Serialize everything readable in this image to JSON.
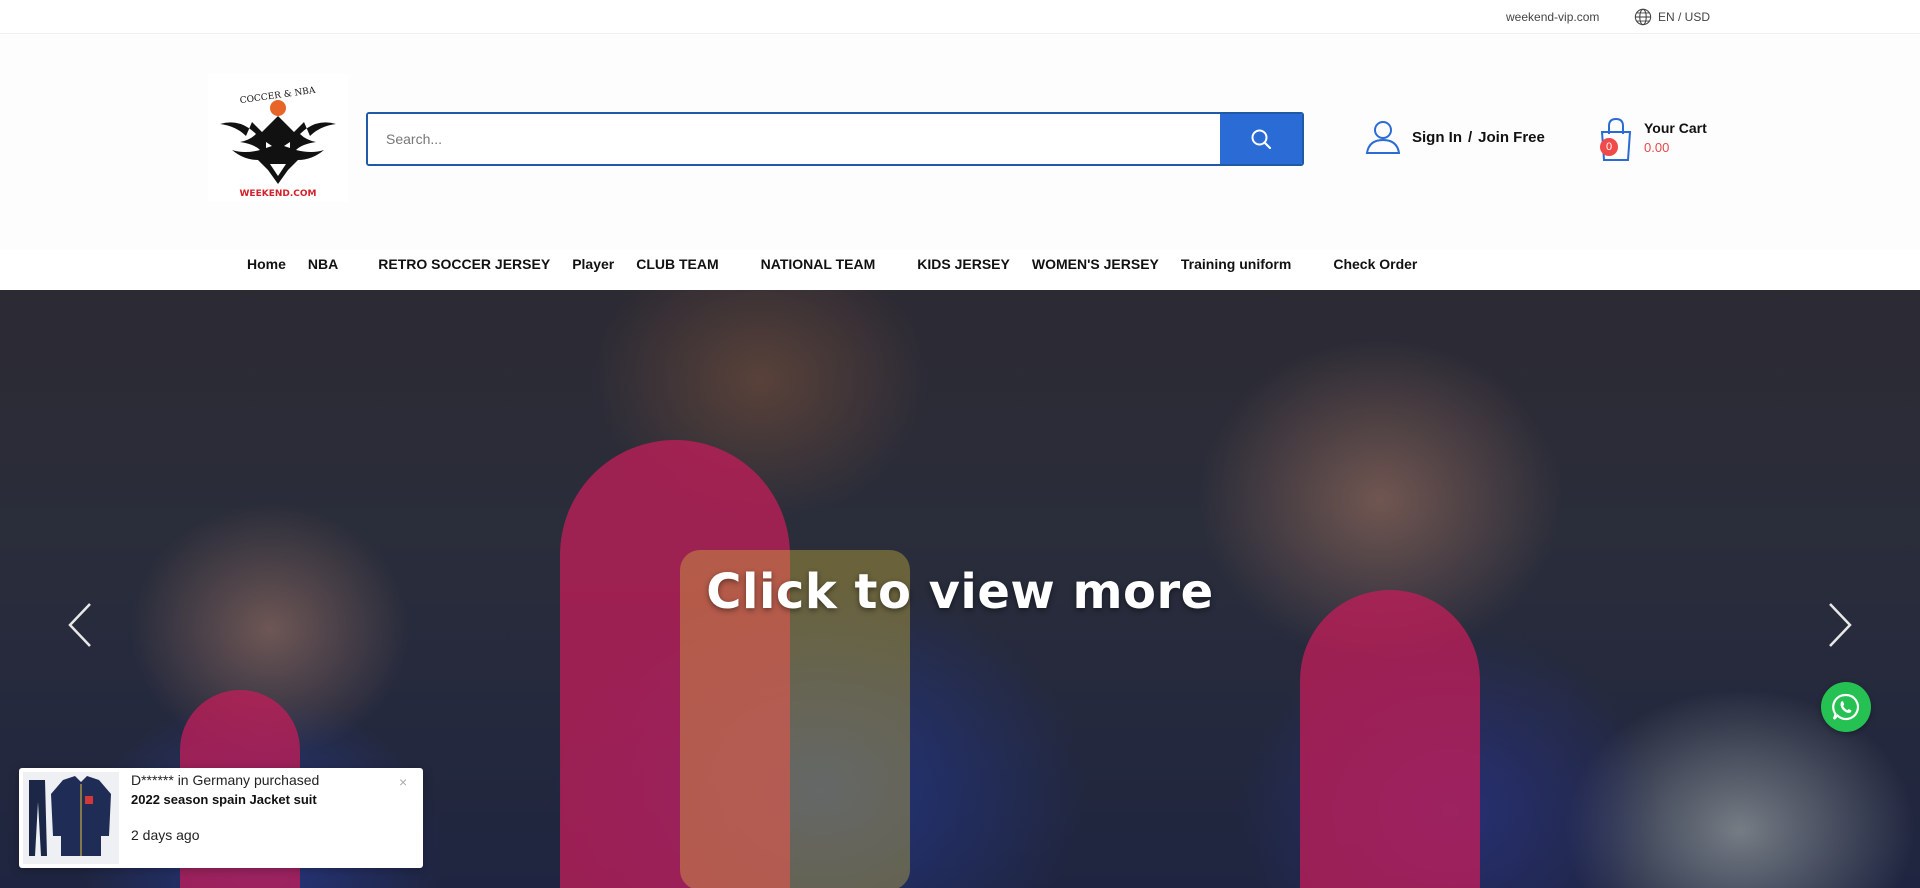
{
  "topbar": {
    "site": "weekend-vip.com",
    "locale": "EN / USD"
  },
  "header": {
    "logo": {
      "top_text": "COCCER & NBA",
      "bottom_text": "WEEKEND.COM"
    },
    "search": {
      "placeholder": "Search...",
      "value": ""
    },
    "account": {
      "sign_in": "Sign In",
      "separator": "/",
      "join": "Join Free"
    },
    "cart": {
      "title": "Your Cart",
      "amount": "0.00",
      "count": "0"
    },
    "accent": "#2a6bd6"
  },
  "nav": {
    "items": [
      {
        "label": "Home"
      },
      {
        "label": "NBA"
      },
      {
        "label": "RETRO SOCCER JERSEY"
      },
      {
        "label": "Player"
      },
      {
        "label": "CLUB TEAM"
      },
      {
        "label": "NATIONAL TEAM"
      },
      {
        "label": "KIDS JERSEY"
      },
      {
        "label": "WOMEN'S JERSEY"
      },
      {
        "label": "Training uniform"
      },
      {
        "label": "Check Order"
      }
    ]
  },
  "hero": {
    "caption": "Click to view more",
    "prev_icon": "chevron-left-icon",
    "next_icon": "chevron-right-icon"
  },
  "whatsapp": {
    "icon": "whatsapp-icon",
    "color": "#25c152"
  },
  "popup": {
    "buyer_text": "D****** in Germany purchased",
    "product": "2022 season spain Jacket suit",
    "time": "2 days ago",
    "close": "×"
  }
}
